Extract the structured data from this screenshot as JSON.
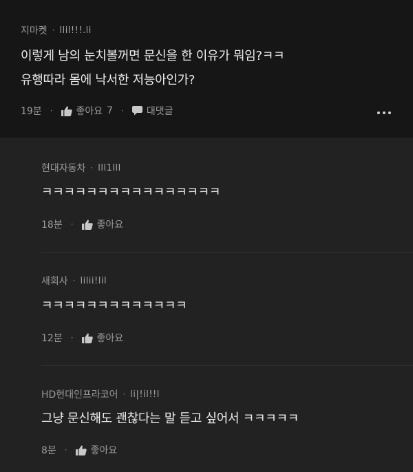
{
  "main_comment": {
    "author": "지마켓",
    "badge": "llil!!!.li",
    "lines": [
      "이렇게 남의 눈치볼꺼면 문신을 한 이유가 뭐임?ㅋㅋ",
      "유행따라 몸에 낙서한 저능아인가?"
    ],
    "time": "19분",
    "like_label": "좋아요",
    "like_count": "7",
    "reply_label": "대댓글"
  },
  "replies": [
    {
      "author": "현대자동차",
      "badge": "lll1lll",
      "text": "ㅋㅋㅋㅋㅋㅋㅋㅋㅋㅋㅋㅋㅋㅋㅋㅋ",
      "time": "18분",
      "like_label": "좋아요"
    },
    {
      "author": "새회사",
      "badge": "lilii!lil",
      "text": "ㅋㅋㅋㅋㅋㅋㅋㅋㅋㅋㅋㅋㅋ",
      "time": "12분",
      "like_label": "좋아요"
    },
    {
      "author": "HD현대인프라코어",
      "badge": "li|!il!!l",
      "text": "그냥 문신해도 괜찮다는 말 듣고 싶어서 ㅋㅋㅋㅋㅋ",
      "time": "8분",
      "like_label": "좋아요"
    }
  ],
  "icons": {
    "like": "thumbs-up-icon",
    "reply": "speech-bubble-icon",
    "more": "more-options-icon"
  },
  "colors": {
    "main_background": "#161616",
    "reply_background": "#222222",
    "text_primary": "#ececec",
    "text_secondary": "#9a9a9a"
  }
}
